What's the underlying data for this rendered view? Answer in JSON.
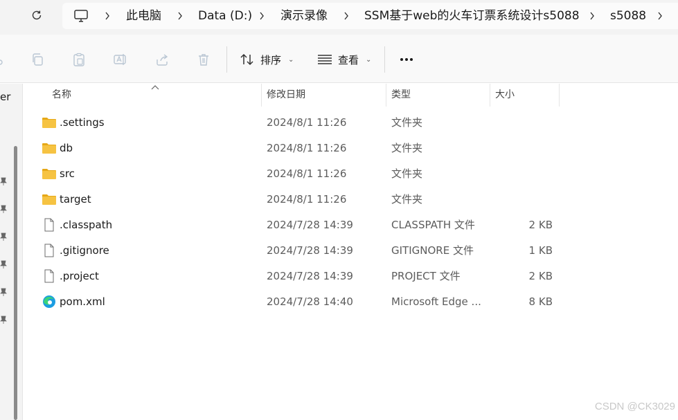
{
  "address_bar": {
    "segments": [
      "此电脑",
      "Data (D:)",
      "演示录像",
      "SSM基于web的火车订票系统设计s5088",
      "s5088"
    ]
  },
  "command_bar": {
    "sort_label": "排序",
    "view_label": "查看"
  },
  "nav_pane": {
    "cut_text": "er"
  },
  "columns": {
    "name": "名称",
    "date": "修改日期",
    "type": "类型",
    "size": "大小"
  },
  "files": [
    {
      "name": ".settings",
      "date": "2024/8/1 11:26",
      "type": "文件夹",
      "size": "",
      "icon": "folder-icon"
    },
    {
      "name": "db",
      "date": "2024/8/1 11:26",
      "type": "文件夹",
      "size": "",
      "icon": "folder-icon"
    },
    {
      "name": "src",
      "date": "2024/8/1 11:26",
      "type": "文件夹",
      "size": "",
      "icon": "folder-icon"
    },
    {
      "name": "target",
      "date": "2024/8/1 11:26",
      "type": "文件夹",
      "size": "",
      "icon": "folder-icon"
    },
    {
      "name": ".classpath",
      "date": "2024/7/28 14:39",
      "type": "CLASSPATH 文件",
      "size": "2 KB",
      "icon": "file-icon"
    },
    {
      "name": ".gitignore",
      "date": "2024/7/28 14:39",
      "type": "GITIGNORE 文件",
      "size": "1 KB",
      "icon": "file-icon"
    },
    {
      "name": ".project",
      "date": "2024/7/28 14:39",
      "type": "PROJECT 文件",
      "size": "2 KB",
      "icon": "file-icon"
    },
    {
      "name": "pom.xml",
      "date": "2024/7/28 14:40",
      "type": "Microsoft Edge ...",
      "size": "8 KB",
      "icon": "edge-icon"
    }
  ],
  "watermark": "CSDN @CK3029",
  "colors": {
    "folder": "#f6c342",
    "folder_dark": "#e6a817",
    "toolbar_bg": "#f9f9f9",
    "address_bg": "#f3f3f3"
  }
}
